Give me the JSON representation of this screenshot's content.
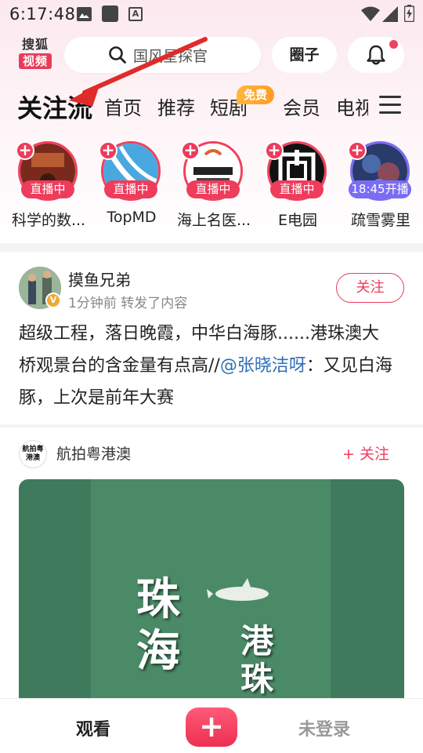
{
  "status_bar": {
    "time": "6:17:48"
  },
  "header": {
    "logo_top": "搜狐",
    "logo_bottom": "视频",
    "search_placeholder": "国风星探官",
    "circle_label": "圈子"
  },
  "tabs": {
    "items": [
      {
        "label": "关注流",
        "active": true
      },
      {
        "label": "首页"
      },
      {
        "label": "推荐"
      },
      {
        "label": "短剧"
      },
      {
        "label": "会员"
      },
      {
        "label": "电视"
      }
    ],
    "free_badge": "免费"
  },
  "live_list": [
    {
      "name": "科学的数...",
      "badge": "直播中"
    },
    {
      "name": "TopMD",
      "badge": "直播中"
    },
    {
      "name": "海上名医...",
      "badge": "直播中"
    },
    {
      "name": "E电园",
      "badge": "直播中"
    },
    {
      "name": "疏雪雾里",
      "badge": "18:45开播"
    }
  ],
  "post": {
    "author": "摸鱼兄弟",
    "meta": "1分钟前 转发了内容",
    "follow_label": "关注",
    "text_before": "超级工程，落日晚霞，中华白海豚......港珠澳大桥观景台的含金量有点高//",
    "mention": "@张晓洁呀",
    "text_after": "：又见白海豚，上次是前年大赛"
  },
  "video_card": {
    "source_logo": "航拍粤港澳",
    "source_name": "航拍粤港澳",
    "follow_label": "+ 关注",
    "overlay_big": "珠海",
    "overlay_small": "港珠"
  },
  "bottom_nav": {
    "watch": "观看",
    "add": "+",
    "login": "未登录"
  },
  "colors": {
    "accent": "#ee3c5c",
    "free_badge": "#ffa52e",
    "link": "#2f6fb5",
    "scheduled_badge": "#7b6cf5"
  }
}
